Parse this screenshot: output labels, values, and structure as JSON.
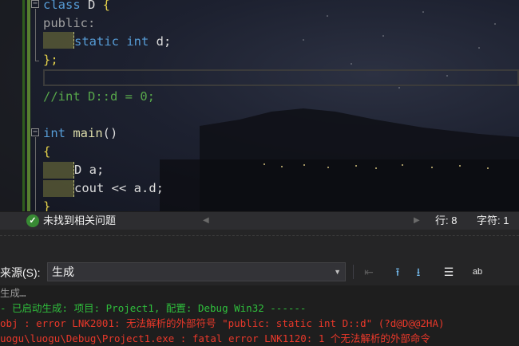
{
  "editor": {
    "lines": [
      [
        {
          "t": "class ",
          "c": "kw"
        },
        {
          "t": "D",
          "c": "id"
        },
        {
          "t": " {",
          "c": "br"
        }
      ],
      [
        {
          "t": "public:",
          "c": "gr"
        }
      ],
      [
        {
          "t": "static int ",
          "c": "kw"
        },
        {
          "t": "d;",
          "c": "id"
        }
      ],
      [
        {
          "t": "};",
          "c": "br"
        }
      ],
      [],
      [
        {
          "t": "//int D::d = 0;",
          "c": "cm"
        }
      ],
      [],
      [
        {
          "t": "int ",
          "c": "kw"
        },
        {
          "t": "main",
          "c": "fn"
        },
        {
          "t": "()",
          "c": "id"
        }
      ],
      [
        {
          "t": "{",
          "c": "br"
        }
      ],
      [
        {
          "t": "D a;",
          "c": "id"
        }
      ],
      [
        {
          "t": "cout << a.d;",
          "c": "id"
        }
      ],
      [
        {
          "t": "}",
          "c": "br"
        }
      ]
    ],
    "fold_minus": "−"
  },
  "status": {
    "ok_icon": "✓",
    "message": "未找到相关问题",
    "line": "行: 8",
    "column": "字符: 1",
    "scroll_left": "◀",
    "scroll_right": "▶"
  },
  "output_panel": {
    "source_label": "来源(S):",
    "source_value": "生成",
    "caret": "▼",
    "toolbar": {
      "prev_icon": "⇤",
      "goto_prev": "⭱",
      "goto_next": "⭳",
      "clear_icon": "☰",
      "wrap_icon": "ab"
    },
    "lines": [
      {
        "text": "生成…",
        "color": "c-gray"
      },
      {
        "text": "- 已启动生成: 项目: Project1, 配置: Debug Win32 ------",
        "color": "c-green"
      },
      {
        "text": "obj : error LNK2001: 无法解析的外部符号 \"public: static int D::d\" (?d@D@@2HA)",
        "color": "c-red"
      },
      {
        "text": "uogu\\luogu\\Debug\\Project1.exe : fatal error LNK1120: 1 个无法解析的外部命令",
        "color": "c-red"
      }
    ]
  }
}
